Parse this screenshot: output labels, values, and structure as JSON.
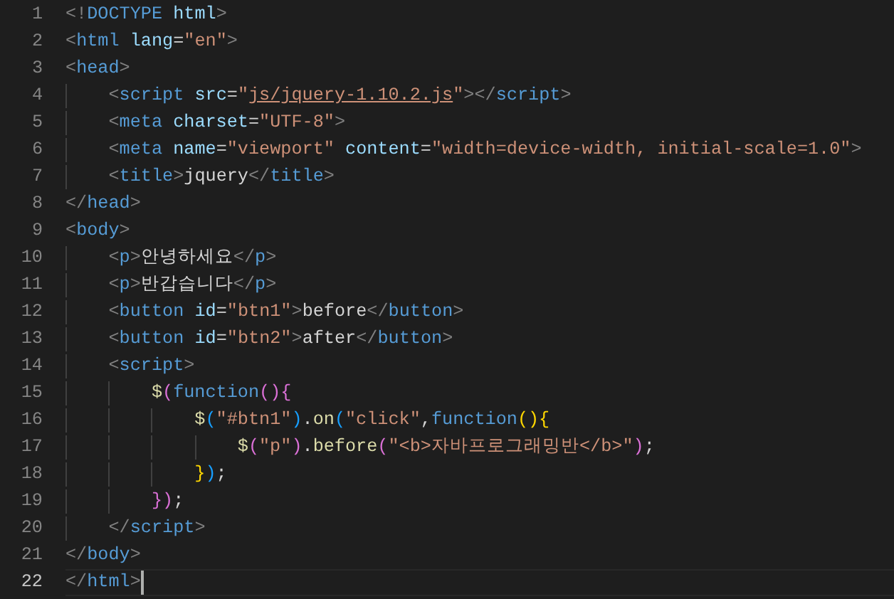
{
  "editor": {
    "lines": [
      {
        "number": "1",
        "current": false,
        "tokens": [
          {
            "kind": "punct",
            "text": "<!"
          },
          {
            "kind": "tag",
            "text": "DOCTYPE"
          },
          {
            "kind": "attr",
            "text": " html"
          },
          {
            "kind": "punct",
            "text": ">"
          }
        ]
      },
      {
        "number": "2",
        "current": false,
        "tokens": [
          {
            "kind": "punct",
            "text": "<"
          },
          {
            "kind": "tag",
            "text": "html"
          },
          {
            "kind": "attr",
            "text": " lang"
          },
          {
            "kind": "text",
            "text": "="
          },
          {
            "kind": "string",
            "text": "\"en\""
          },
          {
            "kind": "punct",
            "text": ">"
          }
        ]
      },
      {
        "number": "3",
        "current": false,
        "tokens": [
          {
            "kind": "punct",
            "text": "<"
          },
          {
            "kind": "tag",
            "text": "head"
          },
          {
            "kind": "punct",
            "text": ">"
          }
        ],
        "children": [
          {
            "number": "4",
            "current": false,
            "tokens": [
              {
                "kind": "punct",
                "text": "<"
              },
              {
                "kind": "tag",
                "text": "script"
              },
              {
                "kind": "attr",
                "text": " src"
              },
              {
                "kind": "text",
                "text": "="
              },
              {
                "kind": "string",
                "text": "\""
              },
              {
                "kind": "link",
                "text": "js/jquery-1.10.2.js"
              },
              {
                "kind": "string",
                "text": "\""
              },
              {
                "kind": "punct",
                "text": "></"
              },
              {
                "kind": "tag",
                "text": "script"
              },
              {
                "kind": "punct",
                "text": ">"
              }
            ]
          },
          {
            "number": "5",
            "current": false,
            "tokens": [
              {
                "kind": "punct",
                "text": "<"
              },
              {
                "kind": "tag",
                "text": "meta"
              },
              {
                "kind": "attr",
                "text": " charset"
              },
              {
                "kind": "text",
                "text": "="
              },
              {
                "kind": "string",
                "text": "\"UTF-8\""
              },
              {
                "kind": "punct",
                "text": ">"
              }
            ]
          },
          {
            "number": "6",
            "current": false,
            "tokens": [
              {
                "kind": "punct",
                "text": "<"
              },
              {
                "kind": "tag",
                "text": "meta"
              },
              {
                "kind": "attr",
                "text": " name"
              },
              {
                "kind": "text",
                "text": "="
              },
              {
                "kind": "string",
                "text": "\"viewport\""
              },
              {
                "kind": "attr",
                "text": " content"
              },
              {
                "kind": "text",
                "text": "="
              },
              {
                "kind": "string",
                "text": "\"width=device-width, initial-scale=1.0\""
              },
              {
                "kind": "punct",
                "text": ">"
              }
            ]
          },
          {
            "number": "7",
            "current": false,
            "tokens": [
              {
                "kind": "punct",
                "text": "<"
              },
              {
                "kind": "tag",
                "text": "title"
              },
              {
                "kind": "punct",
                "text": ">"
              },
              {
                "kind": "text",
                "text": "jquery"
              },
              {
                "kind": "punct",
                "text": "</"
              },
              {
                "kind": "tag",
                "text": "title"
              },
              {
                "kind": "punct",
                "text": ">"
              }
            ]
          }
        ]
      },
      {
        "number": "8",
        "current": false,
        "tokens": [
          {
            "kind": "punct",
            "text": "</"
          },
          {
            "kind": "tag",
            "text": "head"
          },
          {
            "kind": "punct",
            "text": ">"
          }
        ]
      },
      {
        "number": "9",
        "current": false,
        "tokens": [
          {
            "kind": "punct",
            "text": "<"
          },
          {
            "kind": "tag",
            "text": "body"
          },
          {
            "kind": "punct",
            "text": ">"
          }
        ],
        "children": [
          {
            "number": "10",
            "current": false,
            "tokens": [
              {
                "kind": "punct",
                "text": "<"
              },
              {
                "kind": "tag",
                "text": "p"
              },
              {
                "kind": "punct",
                "text": ">"
              },
              {
                "kind": "text",
                "text": "안녕하세요"
              },
              {
                "kind": "punct",
                "text": "</"
              },
              {
                "kind": "tag",
                "text": "p"
              },
              {
                "kind": "punct",
                "text": ">"
              }
            ]
          },
          {
            "number": "11",
            "current": false,
            "tokens": [
              {
                "kind": "punct",
                "text": "<"
              },
              {
                "kind": "tag",
                "text": "p"
              },
              {
                "kind": "punct",
                "text": ">"
              },
              {
                "kind": "text",
                "text": "반갑습니다"
              },
              {
                "kind": "punct",
                "text": "</"
              },
              {
                "kind": "tag",
                "text": "p"
              },
              {
                "kind": "punct",
                "text": ">"
              }
            ]
          },
          {
            "number": "12",
            "current": false,
            "tokens": [
              {
                "kind": "punct",
                "text": "<"
              },
              {
                "kind": "tag",
                "text": "button"
              },
              {
                "kind": "attr",
                "text": " id"
              },
              {
                "kind": "text",
                "text": "="
              },
              {
                "kind": "string",
                "text": "\"btn1\""
              },
              {
                "kind": "punct",
                "text": ">"
              },
              {
                "kind": "text",
                "text": "before"
              },
              {
                "kind": "punct",
                "text": "</"
              },
              {
                "kind": "tag",
                "text": "button"
              },
              {
                "kind": "punct",
                "text": ">"
              }
            ]
          },
          {
            "number": "13",
            "current": false,
            "tokens": [
              {
                "kind": "punct",
                "text": "<"
              },
              {
                "kind": "tag",
                "text": "button"
              },
              {
                "kind": "attr",
                "text": " id"
              },
              {
                "kind": "text",
                "text": "="
              },
              {
                "kind": "string",
                "text": "\"btn2\""
              },
              {
                "kind": "punct",
                "text": ">"
              },
              {
                "kind": "text",
                "text": "after"
              },
              {
                "kind": "punct",
                "text": "</"
              },
              {
                "kind": "tag",
                "text": "button"
              },
              {
                "kind": "punct",
                "text": ">"
              }
            ]
          },
          {
            "number": "14",
            "current": false,
            "tokens": [
              {
                "kind": "punct",
                "text": "<"
              },
              {
                "kind": "tag",
                "text": "script"
              },
              {
                "kind": "punct",
                "text": ">"
              }
            ],
            "children": [
              {
                "number": "15",
                "current": false,
                "tokens": [
                  {
                    "kind": "function",
                    "text": "$"
                  },
                  {
                    "kind": "bracket2",
                    "text": "("
                  },
                  {
                    "kind": "keyword",
                    "text": "function"
                  },
                  {
                    "kind": "bracket2",
                    "text": "(){"
                  }
                ],
                "children": [
                  {
                    "number": "16",
                    "current": false,
                    "tokens": [
                      {
                        "kind": "function",
                        "text": "$"
                      },
                      {
                        "kind": "bracket3",
                        "text": "("
                      },
                      {
                        "kind": "string",
                        "text": "\"#btn1\""
                      },
                      {
                        "kind": "bracket3",
                        "text": ")"
                      },
                      {
                        "kind": "text",
                        "text": "."
                      },
                      {
                        "kind": "function",
                        "text": "on"
                      },
                      {
                        "kind": "bracket3",
                        "text": "("
                      },
                      {
                        "kind": "string",
                        "text": "\"click\""
                      },
                      {
                        "kind": "text",
                        "text": ","
                      },
                      {
                        "kind": "keyword",
                        "text": "function"
                      },
                      {
                        "kind": "bracket1",
                        "text": "(){"
                      }
                    ],
                    "children": [
                      {
                        "number": "17",
                        "current": false,
                        "tokens": [
                          {
                            "kind": "function",
                            "text": "$"
                          },
                          {
                            "kind": "bracket2",
                            "text": "("
                          },
                          {
                            "kind": "string",
                            "text": "\"p\""
                          },
                          {
                            "kind": "bracket2",
                            "text": ")"
                          },
                          {
                            "kind": "text",
                            "text": "."
                          },
                          {
                            "kind": "function",
                            "text": "before"
                          },
                          {
                            "kind": "bracket2",
                            "text": "("
                          },
                          {
                            "kind": "string",
                            "text": "\"<b>자바프로그래밍반</b>\""
                          },
                          {
                            "kind": "bracket2",
                            "text": ")"
                          },
                          {
                            "kind": "text",
                            "text": ";"
                          }
                        ]
                      }
                    ]
                  },
                  {
                    "number": "18",
                    "current": false,
                    "tokens": [
                      {
                        "kind": "bracket1",
                        "text": "}"
                      },
                      {
                        "kind": "bracket3",
                        "text": ")"
                      },
                      {
                        "kind": "text",
                        "text": ";"
                      }
                    ]
                  }
                ]
              },
              {
                "number": "19",
                "current": false,
                "tokens": [
                  {
                    "kind": "bracket2",
                    "text": "})"
                  },
                  {
                    "kind": "text",
                    "text": ";"
                  }
                ]
              }
            ]
          },
          {
            "number": "20",
            "current": false,
            "tokens": [
              {
                "kind": "punct",
                "text": "</"
              },
              {
                "kind": "tag",
                "text": "script"
              },
              {
                "kind": "punct",
                "text": ">"
              }
            ]
          }
        ]
      },
      {
        "number": "21",
        "current": false,
        "tokens": [
          {
            "kind": "punct",
            "text": "</"
          },
          {
            "kind": "tag",
            "text": "body"
          },
          {
            "kind": "punct",
            "text": ">"
          }
        ]
      },
      {
        "number": "22",
        "current": true,
        "tokens": [
          {
            "kind": "punct",
            "text": "</"
          },
          {
            "kind": "tag",
            "text": "html"
          },
          {
            "kind": "punct",
            "text": ">"
          }
        ]
      }
    ]
  }
}
